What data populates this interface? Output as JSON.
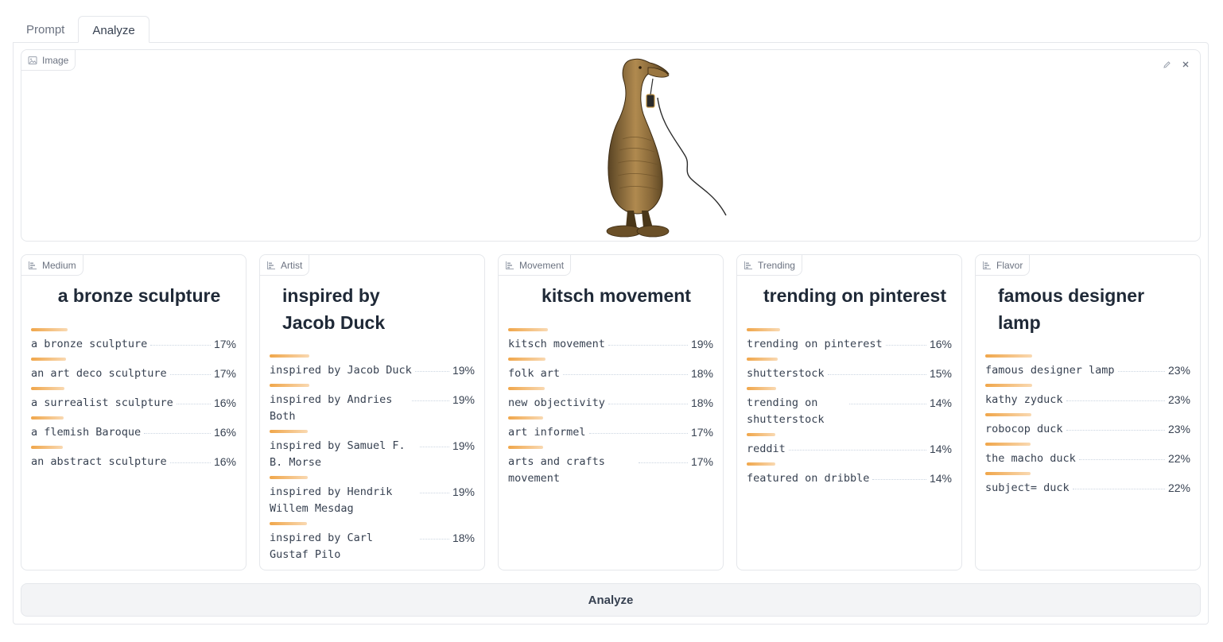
{
  "tabs": [
    {
      "label": "Prompt",
      "active": false
    },
    {
      "label": "Analyze",
      "active": true
    }
  ],
  "image_panel": {
    "label": "Image",
    "edit_icon": "pencil-icon",
    "close_icon": "close-icon"
  },
  "cards": [
    {
      "label": "Medium",
      "title": "a bronze sculpture",
      "rows": [
        {
          "text": "a bronze sculpture",
          "pct": "17%",
          "level": 0.17
        },
        {
          "text": "an art deco sculpture",
          "pct": "17%",
          "level": 0.17
        },
        {
          "text": "a surrealist sculpture",
          "pct": "16%",
          "level": 0.16
        },
        {
          "text": "a flemish Baroque",
          "pct": "16%",
          "level": 0.16
        },
        {
          "text": "an abstract sculpture",
          "pct": "16%",
          "level": 0.16
        }
      ]
    },
    {
      "label": "Artist",
      "title": "inspired by Jacob Duck",
      "rows": [
        {
          "text": "inspired by Jacob Duck",
          "pct": "19%",
          "level": 0.19
        },
        {
          "text": "inspired by Andries Both",
          "pct": "19%",
          "level": 0.19
        },
        {
          "text": "inspired by Samuel F. B. Morse",
          "pct": "19%",
          "level": 0.19
        },
        {
          "text": "inspired by Hendrik Willem Mesdag",
          "pct": "19%",
          "level": 0.19
        },
        {
          "text": "inspired by Carl Gustaf Pilo",
          "pct": "18%",
          "level": 0.18
        }
      ]
    },
    {
      "label": "Movement",
      "title": "kitsch movement",
      "rows": [
        {
          "text": "kitsch movement",
          "pct": "19%",
          "level": 0.19
        },
        {
          "text": "folk art",
          "pct": "18%",
          "level": 0.18
        },
        {
          "text": "new objectivity",
          "pct": "18%",
          "level": 0.18
        },
        {
          "text": "art informel",
          "pct": "17%",
          "level": 0.17
        },
        {
          "text": "arts and crafts movement",
          "pct": "17%",
          "level": 0.17
        }
      ]
    },
    {
      "label": "Trending",
      "title": "trending on pinterest",
      "rows": [
        {
          "text": "trending on pinterest",
          "pct": "16%",
          "level": 0.16
        },
        {
          "text": "shutterstock",
          "pct": "15%",
          "level": 0.15
        },
        {
          "text": "trending on shutterstock",
          "pct": "14%",
          "level": 0.14
        },
        {
          "text": "reddit",
          "pct": "14%",
          "level": 0.14
        },
        {
          "text": "featured on dribble",
          "pct": "14%",
          "level": 0.14
        }
      ]
    },
    {
      "label": "Flavor",
      "title": "famous designer lamp",
      "rows": [
        {
          "text": "famous designer lamp",
          "pct": "23%",
          "level": 0.23
        },
        {
          "text": "kathy zyduck",
          "pct": "23%",
          "level": 0.23
        },
        {
          "text": "robocop duck",
          "pct": "23%",
          "level": 0.23
        },
        {
          "text": "the macho duck",
          "pct": "22%",
          "level": 0.22
        },
        {
          "text": "subject= duck",
          "pct": "22%",
          "level": 0.22
        }
      ]
    }
  ],
  "analyze_button": "Analyze",
  "icons": {
    "image_label": "image-icon",
    "card_label": "bar-chart-icon"
  },
  "colors": {
    "bar_start": "#f0a64a",
    "bar_end": "#f9d9b2",
    "border": "#e5e7eb"
  }
}
